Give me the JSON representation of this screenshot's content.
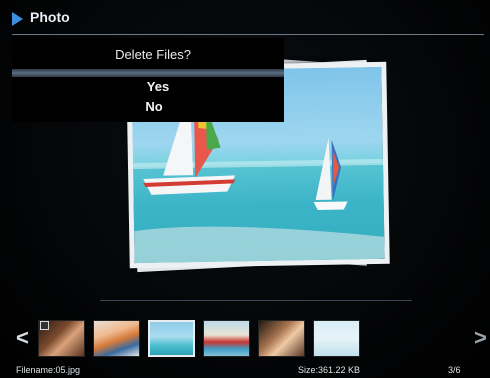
{
  "header": {
    "title": "Photo",
    "icon": "play-icon",
    "accent": "#3d8fe0"
  },
  "dialog": {
    "question": "Delete Files?",
    "options": [
      {
        "label": "Yes",
        "selected": true
      },
      {
        "label": "No",
        "selected": false
      }
    ]
  },
  "thumbnails": [
    {
      "subject": "woman-portrait",
      "selected": false,
      "checked": true
    },
    {
      "subject": "child-portrait",
      "selected": false
    },
    {
      "subject": "sailboat-beach",
      "selected": true
    },
    {
      "subject": "beach-scene",
      "selected": false
    },
    {
      "subject": "couple-portrait",
      "selected": false
    },
    {
      "subject": "sky-scene",
      "selected": false
    }
  ],
  "status": {
    "filename": "Filename:05.jpg",
    "size": "Size:361.22 KB",
    "counter": "3/6"
  }
}
